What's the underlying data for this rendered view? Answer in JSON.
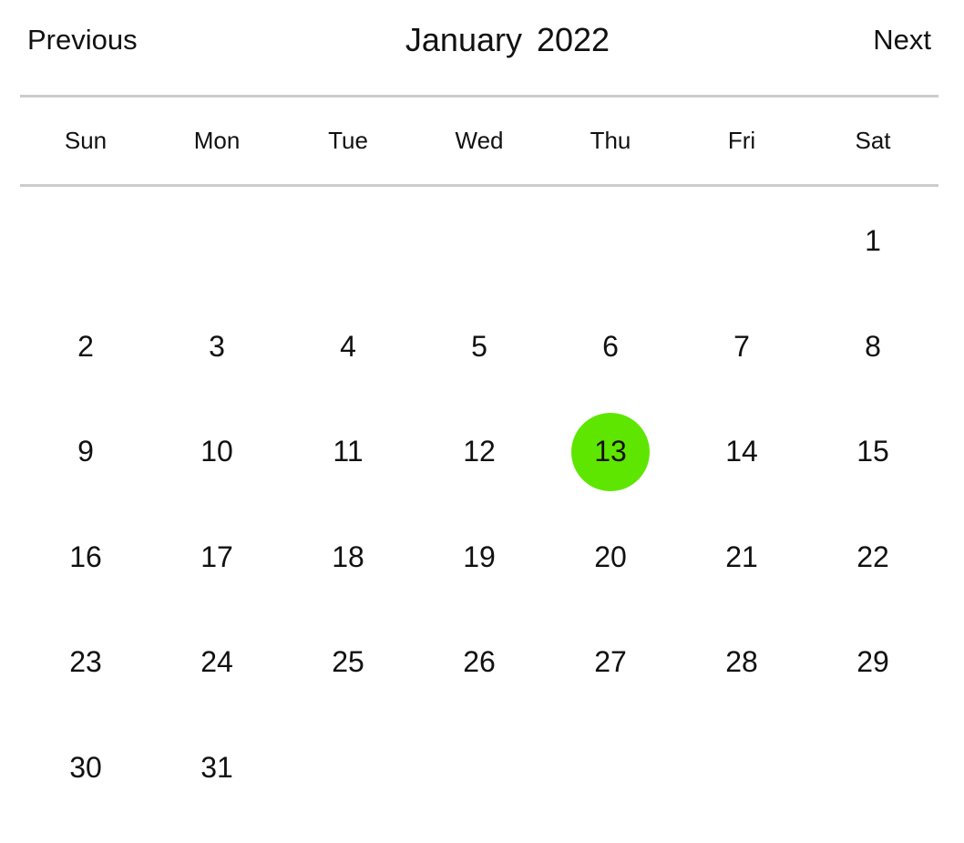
{
  "header": {
    "previous_label": "Previous",
    "next_label": "Next",
    "month": "January",
    "year": "2022",
    "title": "January  2022"
  },
  "weekdays": [
    "Sun",
    "Mon",
    "Tue",
    "Wed",
    "Thu",
    "Fri",
    "Sat"
  ],
  "calendar": {
    "first_weekday_index": 6,
    "days_in_month": 31,
    "selected_day": 13,
    "selected_color": "#5ee600",
    "divider_color": "#cccccc"
  }
}
